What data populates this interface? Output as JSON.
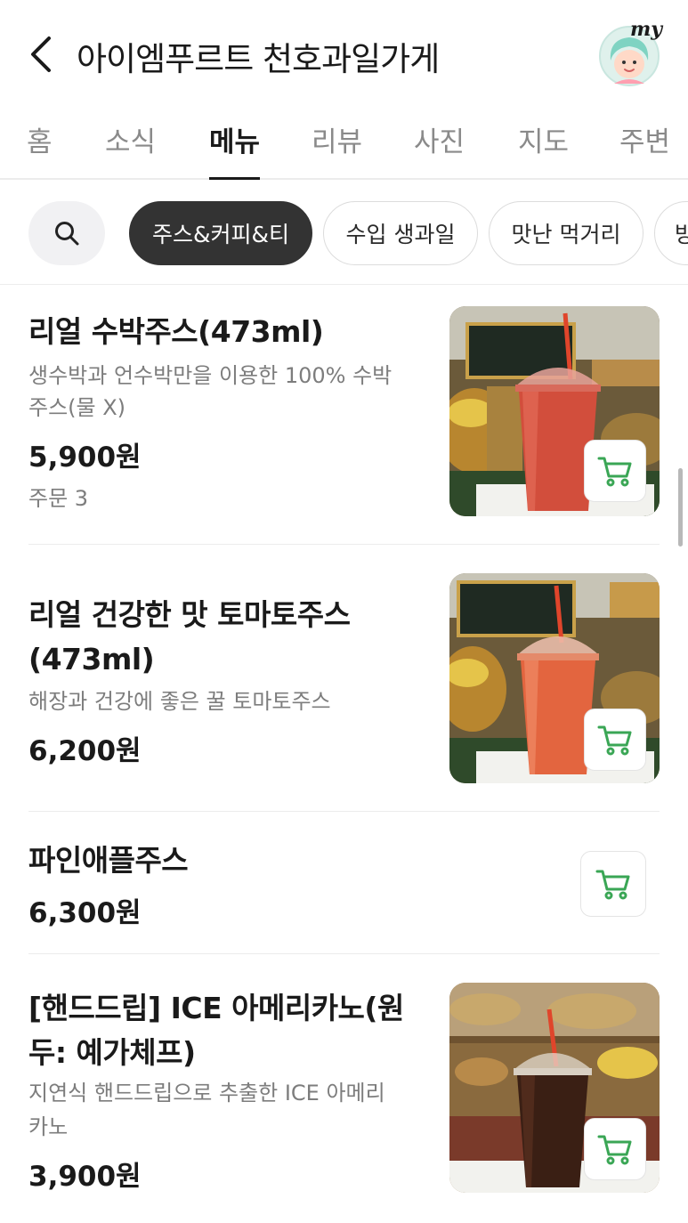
{
  "header": {
    "store_name": "아이엠푸르트 천호과일가게",
    "profile_label": "my"
  },
  "tabs": [
    "홈",
    "소식",
    "메뉴",
    "리뷰",
    "사진",
    "지도",
    "주변"
  ],
  "active_tab": "메뉴",
  "category_chips": [
    "주스&커피&티",
    "수입 생과일",
    "맛난 먹거리",
    "방"
  ],
  "active_chip": "주스&커피&티",
  "menu_items": [
    {
      "name_lines": [
        "리얼 수박주스(473ml)"
      ],
      "desc_lines": [
        "생수박과 언수박만을 이용한 100% 수박",
        "주스(물 X)"
      ],
      "price": "5,900원",
      "orders": "주문 3",
      "photo": "red watermelon juice cup"
    },
    {
      "name_lines": [
        "리얼 건강한 맛 토마토주스",
        "(473ml)"
      ],
      "desc_lines": [
        "해장과 건강에 좋은 꿀 토마토주스"
      ],
      "price": "6,200원",
      "photo": "orange-red tomato juice cup"
    },
    {
      "name_lines": [
        "파인애플주스"
      ],
      "desc_lines": [],
      "price": "6,300원"
    },
    {
      "name_lines": [
        "[핸드드립] ICE 아메리카노(원",
        "두: 예가체프)"
      ],
      "desc_lines": [
        "지연식 핸드드립으로 추출한 ICE 아메리",
        "카노"
      ],
      "price": "3,900원",
      "photo": "iced americano cup"
    }
  ],
  "icons": {
    "back": "chevron-left-icon",
    "search": "search-icon",
    "cart": "cart-icon"
  },
  "colors": {
    "cart_green": "#3aa655",
    "active_chip_bg": "#333333",
    "text_primary": "#1a1a1a",
    "text_secondary": "#7d7d7d"
  }
}
